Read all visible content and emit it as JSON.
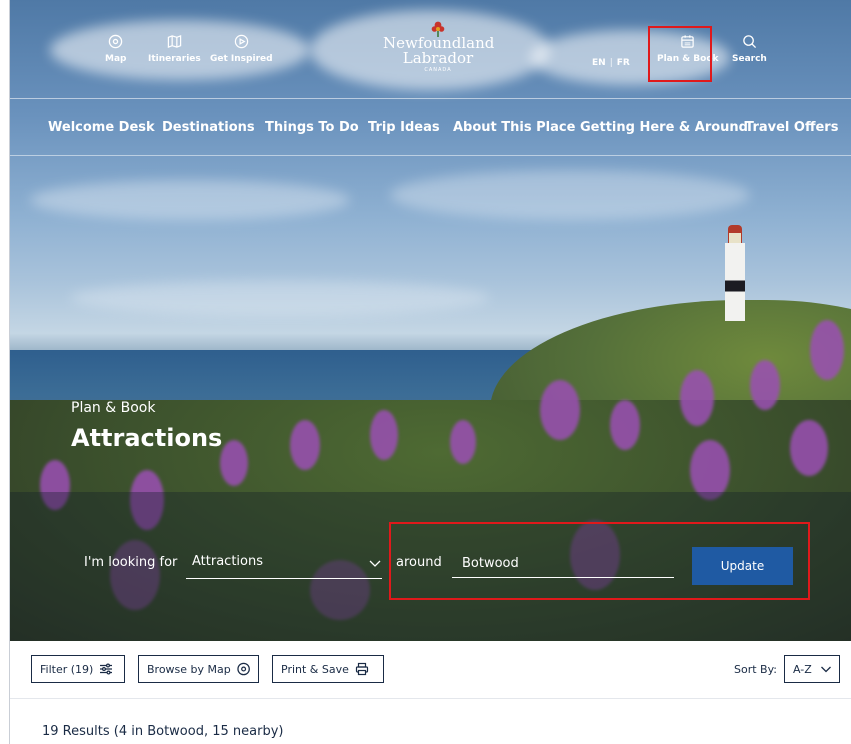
{
  "utility_nav": {
    "map": "Map",
    "itineraries": "Itineraries",
    "get_inspired": "Get Inspired",
    "plan_book": "Plan & Book",
    "search": "Search"
  },
  "logo": {
    "line1": "Newfoundland",
    "line2": "Labrador",
    "line3": "CANADA"
  },
  "lang": {
    "en": "EN",
    "fr": "FR"
  },
  "main_nav": [
    "Welcome Desk",
    "Destinations",
    "Things To Do",
    "Trip Ideas",
    "About This Place",
    "Getting Here & Around",
    "Travel Offers"
  ],
  "hero": {
    "eyebrow": "Plan & Book",
    "title": "Attractions"
  },
  "search": {
    "looking_for_label": "I'm looking for",
    "category_value": "Attractions",
    "around_label": "around",
    "location_value": "Botwood",
    "update_label": "Update"
  },
  "toolbar": {
    "filter_label": "Filter (19)",
    "browse_map_label": "Browse by Map",
    "print_save_label": "Print & Save",
    "sort_label": "Sort By:",
    "sort_value": "A-Z"
  },
  "results_summary": "19 Results (4 in Botwood, 15 nearby)",
  "colors": {
    "accent": "#1f5aa3",
    "highlight": "#e0191b",
    "text": "#1a2b45"
  }
}
